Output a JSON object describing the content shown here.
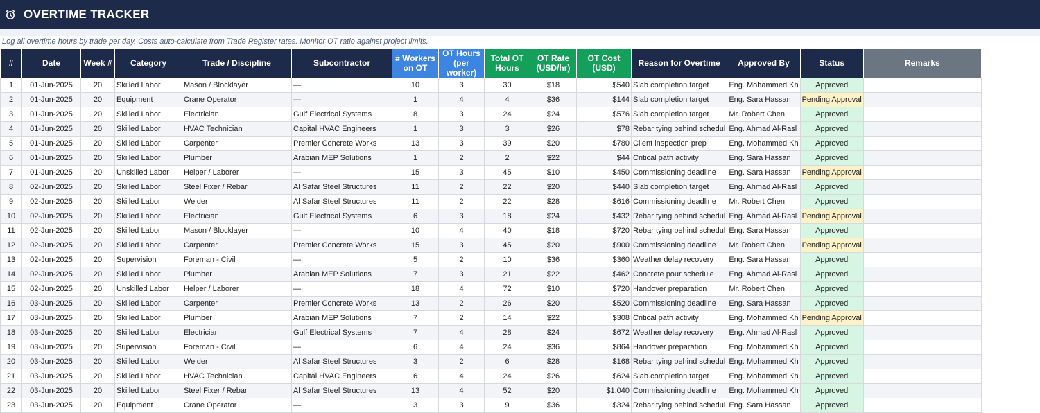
{
  "title": "OVERTIME TRACKER",
  "subtitle": "Log all overtime hours by trade per day. Costs auto-calculate from Trade Register rates. Monitor OT ratio against project limits.",
  "colors": {
    "header_navy": "#1e2a4a",
    "header_blue": "#3d85e0",
    "header_green": "#14a05a",
    "approved": "#d6f5e3",
    "pending": "#fdf1c7"
  },
  "columns": [
    {
      "label": "#",
      "style": "navy"
    },
    {
      "label": "Date",
      "style": "navy"
    },
    {
      "label": "Week #",
      "style": "navy"
    },
    {
      "label": "Category",
      "style": "navy"
    },
    {
      "label": "Trade / Discipline",
      "style": "navy"
    },
    {
      "label": "Subcontractor",
      "style": "navy"
    },
    {
      "label": "# Workers on OT",
      "style": "blue"
    },
    {
      "label": "OT Hours (per worker)",
      "style": "blue"
    },
    {
      "label": "Total OT Hours",
      "style": "green"
    },
    {
      "label": "OT Rate (USD/hr)",
      "style": "green"
    },
    {
      "label": "OT Cost (USD)",
      "style": "green"
    },
    {
      "label": "Reason for Overtime",
      "style": "navy"
    },
    {
      "label": "Approved By",
      "style": "navy"
    },
    {
      "label": "Status",
      "style": "navy"
    },
    {
      "label": "Remarks",
      "style": "gray"
    }
  ],
  "rows": [
    [
      "1",
      "01-Jun-2025",
      "20",
      "Skilled Labor",
      "Mason / Blocklayer",
      "—",
      "10",
      "3",
      "30",
      "$18",
      "$540",
      "Slab completion target",
      "Eng. Mohammed Kh",
      "Approved",
      ""
    ],
    [
      "2",
      "01-Jun-2025",
      "20",
      "Equipment",
      "Crane Operator",
      "—",
      "1",
      "4",
      "4",
      "$36",
      "$144",
      "Slab completion target",
      "Eng. Sara Hassan",
      "Pending Approval",
      ""
    ],
    [
      "3",
      "01-Jun-2025",
      "20",
      "Skilled Labor",
      "Electrician",
      "Gulf Electrical Systems",
      "8",
      "3",
      "24",
      "$24",
      "$576",
      "Slab completion target",
      "Mr. Robert Chen",
      "Approved",
      ""
    ],
    [
      "4",
      "01-Jun-2025",
      "20",
      "Skilled Labor",
      "HVAC Technician",
      "Capital HVAC Engineers",
      "1",
      "3",
      "3",
      "$26",
      "$78",
      "Rebar tying behind schedul",
      "Eng. Ahmad Al-Rasl",
      "Approved",
      ""
    ],
    [
      "5",
      "01-Jun-2025",
      "20",
      "Skilled Labor",
      "Carpenter",
      "Premier Concrete Works",
      "13",
      "3",
      "39",
      "$20",
      "$780",
      "Client inspection prep",
      "Eng. Mohammed Kh",
      "Approved",
      ""
    ],
    [
      "6",
      "01-Jun-2025",
      "20",
      "Skilled Labor",
      "Plumber",
      "Arabian MEP Solutions",
      "1",
      "2",
      "2",
      "$22",
      "$44",
      "Critical path activity",
      "Eng. Sara Hassan",
      "Approved",
      ""
    ],
    [
      "7",
      "01-Jun-2025",
      "20",
      "Unskilled Labor",
      "Helper / Laborer",
      "—",
      "15",
      "3",
      "45",
      "$10",
      "$450",
      "Commissioning deadline",
      "Eng. Sara Hassan",
      "Pending Approval",
      ""
    ],
    [
      "8",
      "02-Jun-2025",
      "20",
      "Skilled Labor",
      "Steel Fixer / Rebar",
      "Al Safar Steel Structures",
      "11",
      "2",
      "22",
      "$20",
      "$440",
      "Slab completion target",
      "Eng. Ahmad Al-Rasl",
      "Approved",
      ""
    ],
    [
      "9",
      "02-Jun-2025",
      "20",
      "Skilled Labor",
      "Welder",
      "Al Safar Steel Structures",
      "11",
      "2",
      "22",
      "$28",
      "$616",
      "Commissioning deadline",
      "Mr. Robert Chen",
      "Approved",
      ""
    ],
    [
      "10",
      "02-Jun-2025",
      "20",
      "Skilled Labor",
      "Electrician",
      "Gulf Electrical Systems",
      "6",
      "3",
      "18",
      "$24",
      "$432",
      "Rebar tying behind schedul",
      "Eng. Ahmad Al-Rasl",
      "Pending Approval",
      ""
    ],
    [
      "11",
      "02-Jun-2025",
      "20",
      "Skilled Labor",
      "Mason / Blocklayer",
      "—",
      "10",
      "4",
      "40",
      "$18",
      "$720",
      "Rebar tying behind schedul",
      "Eng. Sara Hassan",
      "Approved",
      ""
    ],
    [
      "12",
      "02-Jun-2025",
      "20",
      "Skilled Labor",
      "Carpenter",
      "Premier Concrete Works",
      "15",
      "3",
      "45",
      "$20",
      "$900",
      "Commissioning deadline",
      "Mr. Robert Chen",
      "Pending Approval",
      ""
    ],
    [
      "13",
      "02-Jun-2025",
      "20",
      "Supervision",
      "Foreman - Civil",
      "—",
      "5",
      "2",
      "10",
      "$36",
      "$360",
      "Weather delay recovery",
      "Eng. Sara Hassan",
      "Approved",
      ""
    ],
    [
      "14",
      "02-Jun-2025",
      "20",
      "Skilled Labor",
      "Plumber",
      "Arabian MEP Solutions",
      "7",
      "3",
      "21",
      "$22",
      "$462",
      "Concrete pour schedule",
      "Eng. Ahmad Al-Rasl",
      "Approved",
      ""
    ],
    [
      "15",
      "02-Jun-2025",
      "20",
      "Unskilled Labor",
      "Helper / Laborer",
      "—",
      "18",
      "4",
      "72",
      "$10",
      "$720",
      "Handover preparation",
      "Mr. Robert Chen",
      "Approved",
      ""
    ],
    [
      "16",
      "03-Jun-2025",
      "20",
      "Skilled Labor",
      "Carpenter",
      "Premier Concrete Works",
      "13",
      "2",
      "26",
      "$20",
      "$520",
      "Commissioning deadline",
      "Eng. Sara Hassan",
      "Approved",
      ""
    ],
    [
      "17",
      "03-Jun-2025",
      "20",
      "Skilled Labor",
      "Plumber",
      "Arabian MEP Solutions",
      "7",
      "2",
      "14",
      "$22",
      "$308",
      "Critical path activity",
      "Eng. Mohammed Kh",
      "Pending Approval",
      ""
    ],
    [
      "18",
      "03-Jun-2025",
      "20",
      "Skilled Labor",
      "Electrician",
      "Gulf Electrical Systems",
      "7",
      "4",
      "28",
      "$24",
      "$672",
      "Weather delay recovery",
      "Eng. Ahmad Al-Rasl",
      "Approved",
      ""
    ],
    [
      "19",
      "03-Jun-2025",
      "20",
      "Supervision",
      "Foreman - Civil",
      "—",
      "6",
      "4",
      "24",
      "$36",
      "$864",
      "Handover preparation",
      "Eng. Mohammed Kh",
      "Approved",
      ""
    ],
    [
      "20",
      "03-Jun-2025",
      "20",
      "Skilled Labor",
      "Welder",
      "Al Safar Steel Structures",
      "3",
      "2",
      "6",
      "$28",
      "$168",
      "Rebar tying behind schedul",
      "Eng. Mohammed Kh",
      "Approved",
      ""
    ],
    [
      "21",
      "03-Jun-2025",
      "20",
      "Skilled Labor",
      "HVAC Technician",
      "Capital HVAC Engineers",
      "6",
      "4",
      "24",
      "$26",
      "$624",
      "Slab completion target",
      "Eng. Mohammed Kh",
      "Approved",
      ""
    ],
    [
      "22",
      "03-Jun-2025",
      "20",
      "Skilled Labor",
      "Steel Fixer / Rebar",
      "Al Safar Steel Structures",
      "13",
      "4",
      "52",
      "$20",
      "$1,040",
      "Commissioning deadline",
      "Eng. Mohammed Kh",
      "Approved",
      ""
    ],
    [
      "23",
      "03-Jun-2025",
      "20",
      "Equipment",
      "Crane Operator",
      "—",
      "3",
      "3",
      "9",
      "$36",
      "$324",
      "Rebar tying behind schedul",
      "Eng. Sara Hassan",
      "Approved",
      ""
    ]
  ]
}
